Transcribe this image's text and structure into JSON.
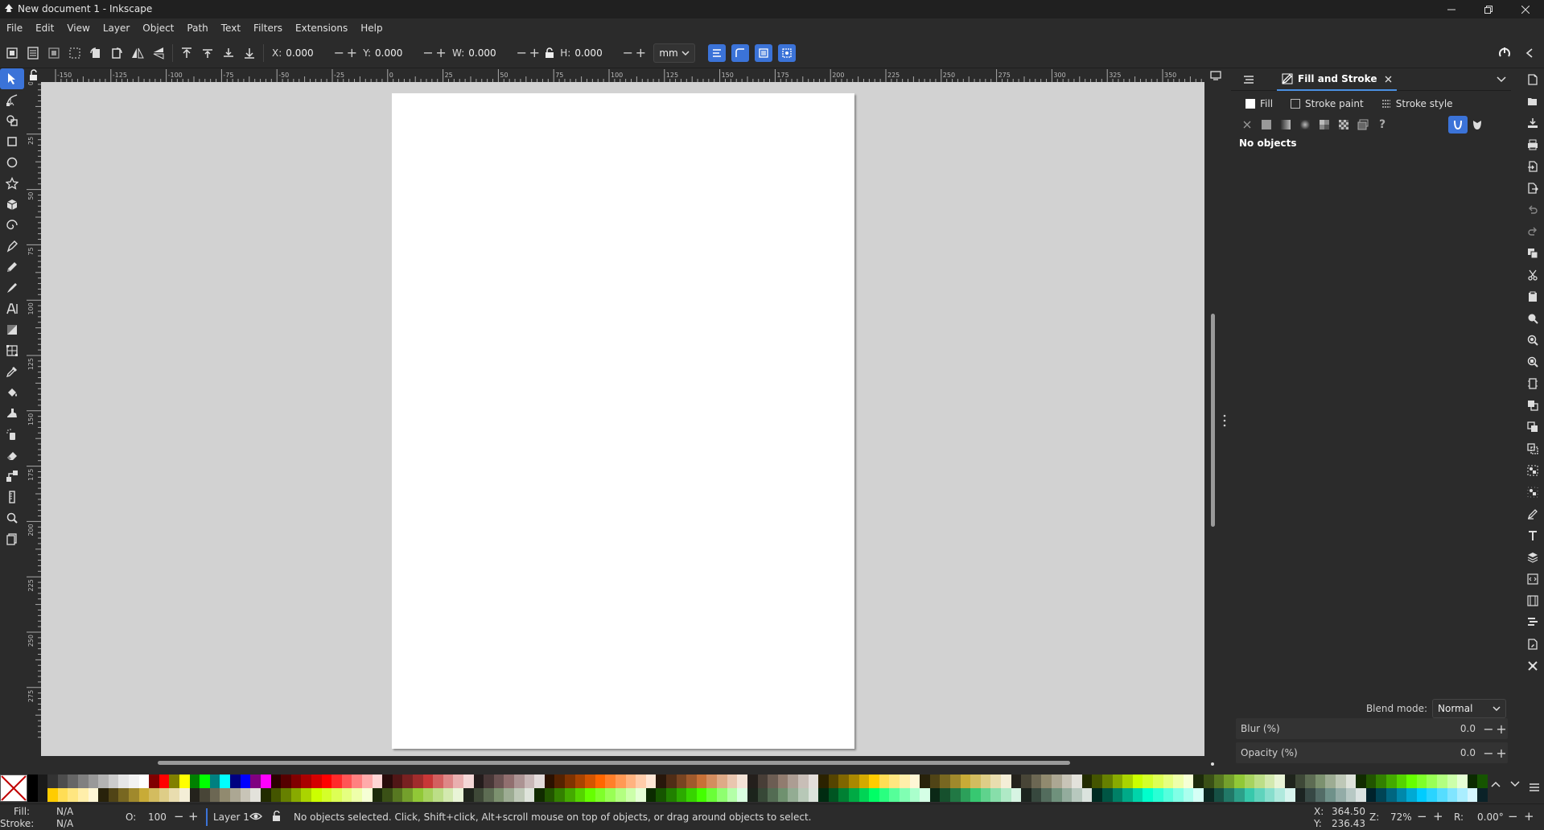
{
  "window": {
    "title": "New document 1 - Inkscape"
  },
  "menu": [
    "File",
    "Edit",
    "View",
    "Layer",
    "Object",
    "Path",
    "Text",
    "Filters",
    "Extensions",
    "Help"
  ],
  "toolbar": {
    "x_label": "X:",
    "x_value": "0.000",
    "y_label": "Y:",
    "y_value": "0.000",
    "w_label": "W:",
    "w_value": "0.000",
    "h_label": "H:",
    "h_value": "0.000",
    "unit": "mm"
  },
  "ruler_top": [
    "-150",
    "-125",
    "-100",
    "-75",
    "-50",
    "-25",
    "0",
    "25",
    "50",
    "75",
    "100",
    "125",
    "150",
    "175",
    "200",
    "225",
    "250",
    "275",
    "300",
    "325",
    "350"
  ],
  "ruler_left": [
    "0",
    "25",
    "50",
    "75",
    "100",
    "125",
    "150",
    "175",
    "200",
    "225",
    "250",
    "275"
  ],
  "dock": {
    "tab_label": "Fill and Stroke",
    "subtabs": [
      "Fill",
      "Stroke paint",
      "Stroke style"
    ],
    "no_objects": "No objects",
    "blend_label": "Blend mode:",
    "blend_value": "Normal",
    "blur_label": "Blur (%)",
    "blur_value": "0.0",
    "opacity_label": "Opacity (%)",
    "opacity_value": "0.0"
  },
  "palette": {
    "top_row": [
      "#000000",
      "#1a1a1a",
      "#333333",
      "#4d4d4d",
      "#666666",
      "#808080",
      "#999999",
      "#b3b3b3",
      "#cccccc",
      "#e6e6e6",
      "#f2f2f2",
      "#ffffff",
      "#800000",
      "#ff0000",
      "#808000",
      "#ffff00",
      "#008000",
      "#00ff00",
      "#008080",
      "#00ffff",
      "#000080",
      "#0000ff",
      "#800080",
      "#ff00ff",
      "#2b0000",
      "#550000",
      "#800000",
      "#aa0000",
      "#d40000",
      "#ff0000",
      "#ff2a2a",
      "#ff5555",
      "#ff8080",
      "#ffaaaa",
      "#ffd5d5",
      "#280b0b",
      "#501616",
      "#782121",
      "#a02c2c",
      "#c83737",
      "#d35f5f",
      "#de8787",
      "#e9afaf",
      "#f4d7d7",
      "#241c1c",
      "#483737",
      "#6c5353",
      "#916f6f",
      "#ac9393",
      "#c8b7b7",
      "#e3dbdb",
      "#2b1100",
      "#552200",
      "#803300",
      "#aa4400",
      "#d45500",
      "#ff6600",
      "#ff7f2a",
      "#ff9955",
      "#ffb380",
      "#ffccaa",
      "#ffe6d5",
      "#28170b",
      "#502d16",
      "#784421",
      "#a05a2c",
      "#c87137",
      "#d38d5f",
      "#deaa87",
      "#e9c6af",
      "#f4e3d7",
      "#241f1c",
      "#483e37",
      "#6c5d53",
      "#917c6f",
      "#ac9d93",
      "#c8beb7",
      "#e3dedb",
      "#2b2200",
      "#554400",
      "#806600",
      "#aa8800",
      "#d4aa00",
      "#ffcc00",
      "#ffdd55",
      "#ffe680",
      "#ffeeaa",
      "#fff6d5",
      "#28220b",
      "#504416",
      "#786721",
      "#a0892c",
      "#c8ab37",
      "#d3bc5f",
      "#decd87",
      "#e9ddaf",
      "#f4eed7",
      "#24221c",
      "#484537",
      "#6c6753",
      "#918a6f",
      "#aca793",
      "#c8c4b7",
      "#e3e2db",
      "#222b00",
      "#445500",
      "#668000",
      "#88aa00",
      "#aad400",
      "#ccff00",
      "#d4ff2a",
      "#ddff55",
      "#e5ff80",
      "#eeffaa",
      "#f6ffd5",
      "#1d2b0b",
      "#3a5016",
      "#577821",
      "#74a02c",
      "#91c837",
      "#a7d35f",
      "#bcde87",
      "#d3e9af",
      "#e9f4d7",
      "#1f241c",
      "#3e4837",
      "#5d6c53",
      "#7c916f",
      "#9dac93",
      "#bec8b7",
      "#dee3db",
      "#112b00",
      "#225500",
      "#338000",
      "#44aa00",
      "#55d400",
      "#66ff00",
      "#7fff2a",
      "#99ff55",
      "#b3ff80",
      "#ccffaa",
      "#e5ffd5",
      "#0b2b00",
      "#165500",
      "#218000",
      "#2caa00",
      "#37d400",
      "#00aa00",
      "#008000",
      "#006600"
    ],
    "bottom_row": [
      "#000000",
      "#1a1a1a",
      "#ffcc00",
      "#ffdd55",
      "#ffe680",
      "#ffeeaa",
      "#fff6d5",
      "#28220b",
      "#504416",
      "#786721",
      "#a0892c",
      "#c8ab37",
      "#d3bc5f",
      "#decd87",
      "#e9ddaf",
      "#f4eed7",
      "#24221c",
      "#484537",
      "#6c6753",
      "#918a6f",
      "#aca793",
      "#c8c4b7",
      "#e3e2db",
      "#222b00",
      "#445500",
      "#668000",
      "#88aa00",
      "#aad400",
      "#ccff00",
      "#d4ff2a",
      "#ddff55",
      "#e5ff80",
      "#eeffaa",
      "#f6ffd5",
      "#1d2b0b",
      "#3a5016",
      "#577821",
      "#74a02c",
      "#91c837",
      "#a7d35f",
      "#bcde87",
      "#d3e9af",
      "#e9f4d7",
      "#1f241c",
      "#3e4837",
      "#5d6c53",
      "#7c916f",
      "#9dac93",
      "#bec8b7",
      "#dee3db",
      "#112b00",
      "#225500",
      "#338000",
      "#44aa00",
      "#55d400",
      "#66ff00",
      "#7fff2a",
      "#99ff55",
      "#b3ff80",
      "#ccffaa",
      "#e5ffd5",
      "#0b2b00",
      "#165500",
      "#218000",
      "#2caa00",
      "#37d400",
      "#44ff00",
      "#6aff38",
      "#8fff70",
      "#b4ffa8",
      "#d9ffe0",
      "#1c241c",
      "#374837",
      "#536c53",
      "#6f916f",
      "#93ac93",
      "#b7c8b7",
      "#dbe3db",
      "#002b11",
      "#005522",
      "#008033",
      "#00aa44",
      "#00d455",
      "#00ff66",
      "#2aff80",
      "#55ff99",
      "#80ffb3",
      "#aaffcc",
      "#d5ffe6",
      "#0b2816",
      "#16502d",
      "#217844",
      "#2ca05a",
      "#37c871",
      "#5fd38d",
      "#87deaa",
      "#afe9c6",
      "#d7f4e3",
      "#1c241f",
      "#37483e",
      "#536c5d",
      "#6f917c",
      "#93ac9d",
      "#b7c8be",
      "#dbe3de",
      "#002b22",
      "#005544",
      "#008066",
      "#00aa88",
      "#00d4aa",
      "#00ffcc",
      "#2affd5",
      "#55ffdd",
      "#80ffe6",
      "#aaffee",
      "#d5fff6",
      "#0b2822",
      "#165044",
      "#217867",
      "#2ca089",
      "#37c8ab",
      "#5fd3bc",
      "#87decd",
      "#afe9dd",
      "#d7f4ee",
      "#1c2422",
      "#374845",
      "#536c67",
      "#6f918a",
      "#93aca7",
      "#b7c8c4",
      "#dbe3e2",
      "#00222b",
      "#004455",
      "#006680",
      "#0088aa",
      "#00aad4",
      "#00ccff",
      "#2ad4ff",
      "#55ddff",
      "#80e5ff",
      "#aaeeff",
      "#d5f6ff",
      "#0b2228"
    ]
  },
  "status": {
    "fill_label": "Fill:",
    "fill_value": "N/A",
    "stroke_label": "Stroke:",
    "stroke_value": "N/A",
    "opacity_label": "O:",
    "opacity_value": "100",
    "layer": "Layer 1",
    "message": "No objects selected. Click, Shift+click, Alt+scroll mouse on top of objects, or drag around objects to select.",
    "x_label": "X:",
    "x_value": "364.50",
    "y_label": "Y:",
    "y_value": "236.43",
    "zoom_label": "Z:",
    "zoom_value": "72%",
    "rotate_label": "R:",
    "rotate_value": "0.00°"
  },
  "colors": {
    "accent": "#3b73d8",
    "page": "#ffffff",
    "canvas": "#d2d2d2",
    "chrome": "#2b2b2b"
  }
}
